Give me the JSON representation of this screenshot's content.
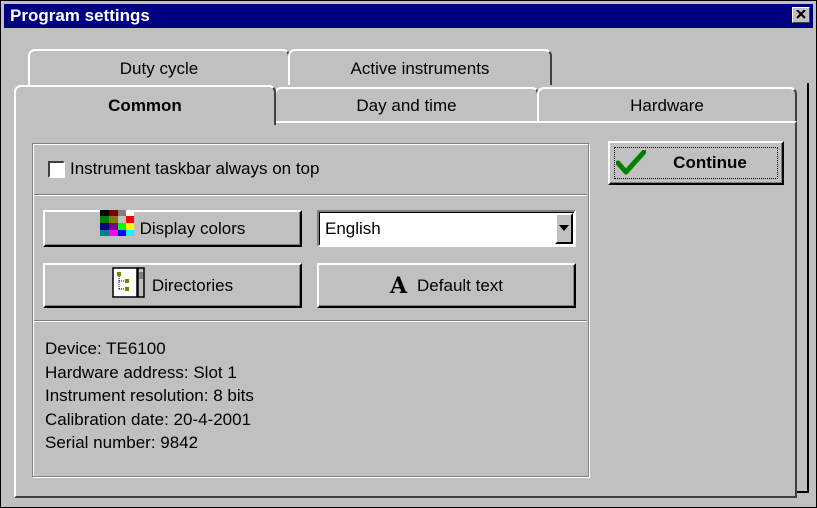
{
  "window": {
    "title": "Program settings"
  },
  "tabs": {
    "back_row": [
      {
        "label": "Duty cycle"
      },
      {
        "label": "Active instruments"
      }
    ],
    "front_row": [
      {
        "label": "Common",
        "selected": true
      },
      {
        "label": "Day and time"
      },
      {
        "label": "Hardware"
      }
    ]
  },
  "common": {
    "taskbar_checkbox_label": "Instrument taskbar always on top",
    "taskbar_checked": false,
    "display_colors_label": "Display colors",
    "language_value": "English",
    "directories_label": "Directories",
    "default_text_label": "Default text",
    "default_text_icon_glyph": "A",
    "info": {
      "device": "Device: TE6100",
      "hardware_address": "Hardware address: Slot 1",
      "resolution": "Instrument resolution: 8 bits",
      "calibration": "Calibration date: 20-4-2001",
      "serial": "Serial number: 9842"
    }
  },
  "actions": {
    "continue_label": "Continue"
  },
  "colors": {
    "titlebar": "#000080",
    "face": "#c0c0c0",
    "check_green": "#008000"
  }
}
